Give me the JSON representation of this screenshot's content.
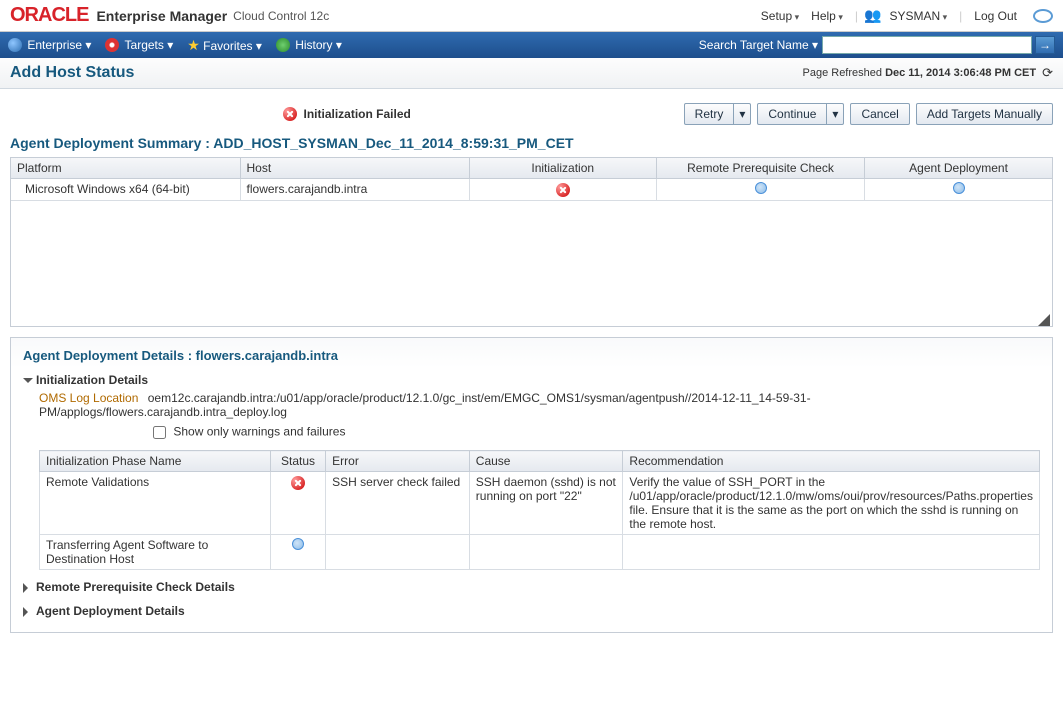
{
  "header": {
    "logo": "ORACLE",
    "product": "Enterprise Manager",
    "subproduct": "Cloud Control 12c",
    "setup": "Setup",
    "help": "Help",
    "user": "SYSMAN",
    "logout": "Log Out"
  },
  "nav": {
    "enterprise": "Enterprise",
    "targets": "Targets",
    "favorites": "Favorites",
    "history": "History",
    "search_label": "Search Target Name",
    "search_placeholder": ""
  },
  "page": {
    "title": "Add Host Status",
    "refresh_label": "Page Refreshed",
    "refresh_time": "Dec 11, 2014 3:06:48 PM CET"
  },
  "status_banner": "Initialization Failed",
  "buttons": {
    "retry": "Retry",
    "continue": "Continue",
    "cancel": "Cancel",
    "add_manual": "Add Targets Manually"
  },
  "summary": {
    "title": "Agent Deployment Summary : ADD_HOST_SYSMAN_Dec_11_2014_8:59:31_PM_CET",
    "cols": {
      "platform": "Platform",
      "host": "Host",
      "init": "Initialization",
      "remote": "Remote Prerequisite Check",
      "deploy": "Agent Deployment"
    },
    "row": {
      "platform": "Microsoft Windows x64 (64-bit)",
      "host": "flowers.carajandb.intra"
    }
  },
  "details": {
    "title": "Agent Deployment Details : flowers.carajandb.intra",
    "init_section": "Initialization Details",
    "oms_label": "OMS Log Location",
    "oms_path": "oem12c.carajandb.intra:/u01/app/oracle/product/12.1.0/gc_inst/em/EMGC_OMS1/sysman/agentpush//2014-12-11_14-59-31-PM/applogs/flowers.carajandb.intra_deploy.log",
    "show_warn": "Show only warnings and failures",
    "table": {
      "cols": {
        "phase": "Initialization Phase Name",
        "status": "Status",
        "error": "Error",
        "cause": "Cause",
        "rec": "Recommendation"
      },
      "rows": [
        {
          "phase": "Remote Validations",
          "status": "error",
          "error": "SSH server check failed",
          "cause": "SSH daemon (sshd) is not running on port \"22\"",
          "rec": "Verify the value of SSH_PORT in the /u01/app/oracle/product/12.1.0/mw/oms/oui/prov/resources/Paths.properties file. Ensure that it is the same as the port on which the sshd is running on the remote host."
        },
        {
          "phase": "Transferring Agent Software to Destination Host",
          "status": "pending",
          "error": "",
          "cause": "",
          "rec": ""
        }
      ]
    },
    "remote_section": "Remote Prerequisite Check Details",
    "deploy_section": "Agent Deployment Details"
  }
}
